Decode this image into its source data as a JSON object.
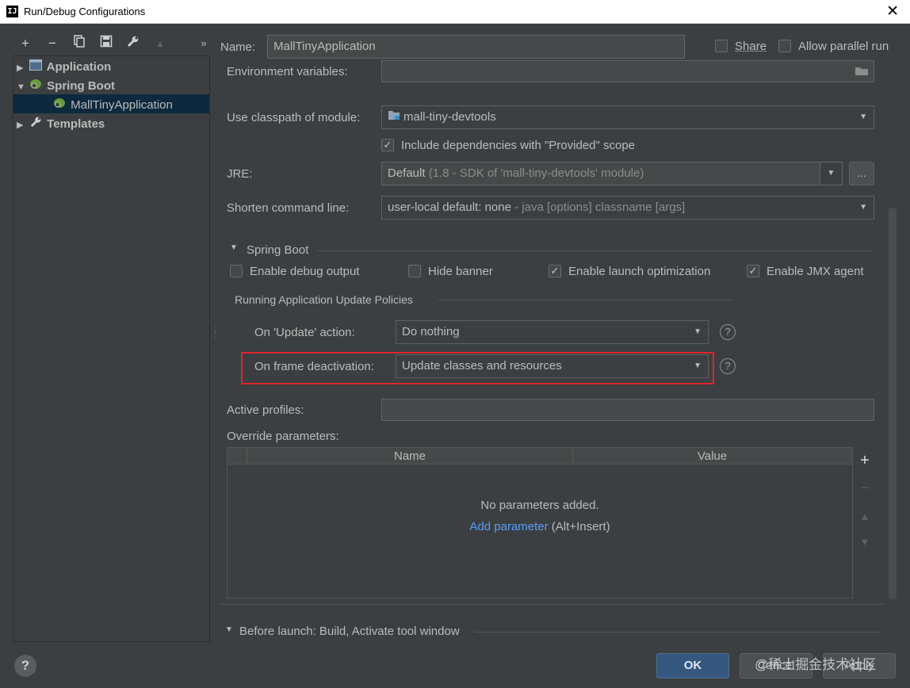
{
  "window": {
    "title": "Run/Debug Configurations",
    "close_glyph": "✕",
    "app_icon_text": "IJ"
  },
  "toolbar": {
    "icons": [
      "add-icon",
      "remove-icon",
      "copy-icon",
      "save-icon",
      "wrench-icon",
      "move-up-icon",
      "more-icon"
    ],
    "overflow": "»"
  },
  "tree": {
    "items": [
      {
        "label": "Application",
        "icon": "application-icon",
        "expanded": false
      },
      {
        "label": "Spring Boot",
        "icon": "spring-boot-icon",
        "expanded": true
      },
      {
        "label": "MallTinyApplication",
        "icon": "spring-app-icon",
        "selected": true
      },
      {
        "label": "Templates",
        "icon": "wrench-icon",
        "expanded": false
      }
    ]
  },
  "header": {
    "name_label": "Name:",
    "name_value": "MallTinyApplication",
    "share_label": "Share",
    "parallel_label": "Allow parallel run"
  },
  "form": {
    "env_label": "Environment variables:",
    "classpath_label": "Use classpath of module:",
    "classpath_value": "mall-tiny-devtools",
    "include_deps_label": "Include dependencies with \"Provided\" scope",
    "jre_label": "JRE:",
    "jre_value": "Default",
    "jre_detail": " (1.8 - SDK of 'mall-tiny-devtools' module)",
    "jre_browse": "...",
    "shorten_label": "Shorten command line:",
    "shorten_value": "user-local default: none",
    "shorten_detail": " - java [options] classname [args]"
  },
  "spring_boot": {
    "section_title": "Spring Boot",
    "debug_output": "Enable debug output",
    "hide_banner": "Hide banner",
    "launch_opt": "Enable launch optimization",
    "jmx": "Enable JMX agent",
    "policies_title": "Running Application Update Policies",
    "update_action_label": "On 'Update' action:",
    "update_action_value": "Do nothing",
    "frame_deactivation_label": "On frame deactivation:",
    "frame_deactivation_value": "Update classes and resources",
    "help_glyph": "?"
  },
  "profiles": {
    "label": "Active profiles:",
    "value": ""
  },
  "override": {
    "label": "Override parameters:",
    "columns": [
      "Name",
      "Value"
    ],
    "empty_text": "No parameters added.",
    "add_link": "Add parameter",
    "add_shortcut": " (Alt+Insert)"
  },
  "before_launch": {
    "label": "Before launch: Build, Activate tool window"
  },
  "buttons": {
    "ok": "OK",
    "cancel": "Cancel",
    "apply": "Apply",
    "help": "?"
  },
  "watermark": "@稀土掘金技术社区",
  "colors": {
    "accent": "#365880",
    "highlight": "#e0242f",
    "link": "#589df6",
    "selection": "#0d293e"
  }
}
